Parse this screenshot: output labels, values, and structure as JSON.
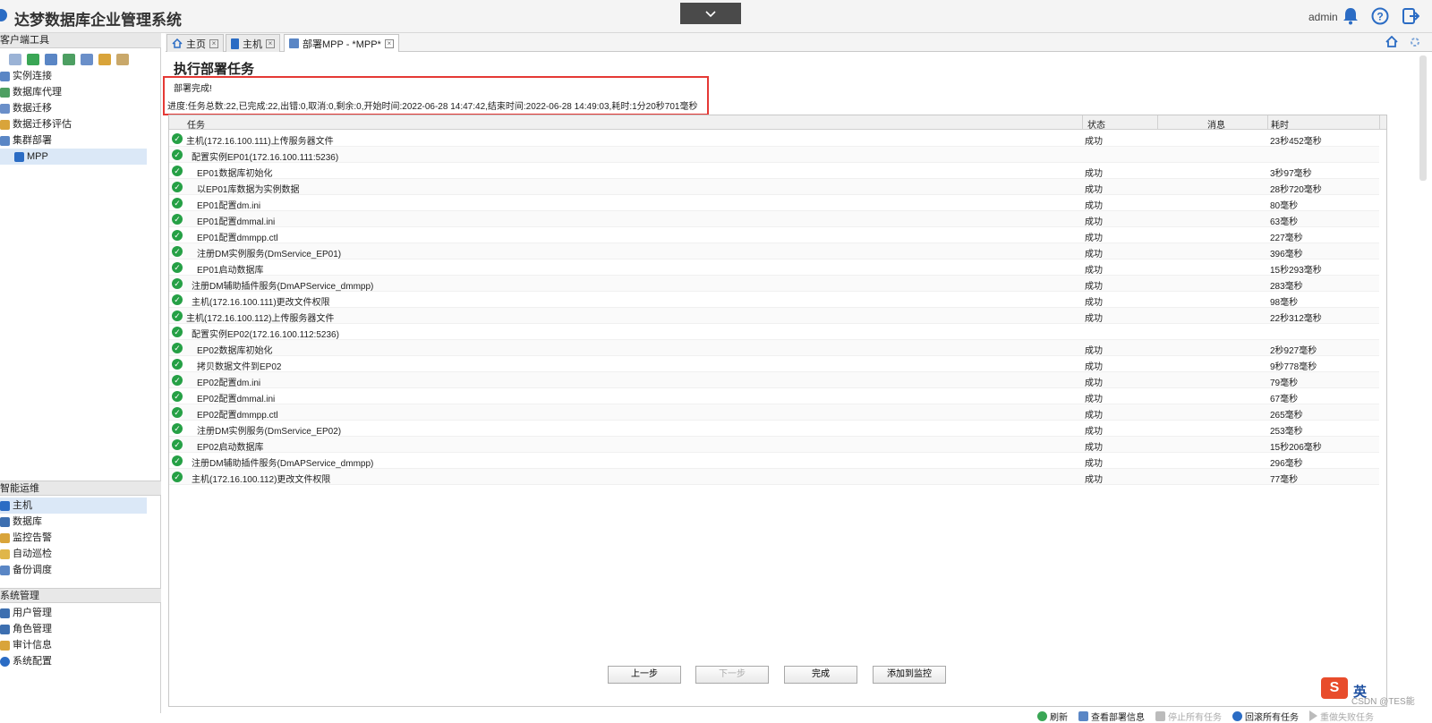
{
  "app": {
    "title": "达梦数据库企业管理系统",
    "user": "admin"
  },
  "sidebar": {
    "client_tools": {
      "title": "客户端工具",
      "items": [
        {
          "label": "实例连接"
        },
        {
          "label": "数据库代理"
        },
        {
          "label": "数据迁移"
        },
        {
          "label": "数据迁移评估"
        },
        {
          "label": "集群部署"
        },
        {
          "label": "MPP"
        }
      ]
    },
    "ops": {
      "title": "智能运维",
      "items": [
        {
          "label": "主机"
        },
        {
          "label": "数据库"
        },
        {
          "label": "监控告警"
        },
        {
          "label": "自动巡检"
        },
        {
          "label": "备份调度"
        }
      ]
    },
    "sys": {
      "title": "系统管理",
      "items": [
        {
          "label": "用户管理"
        },
        {
          "label": "角色管理"
        },
        {
          "label": "审计信息"
        },
        {
          "label": "系统配置"
        }
      ]
    }
  },
  "tabs": [
    {
      "label": "主页"
    },
    {
      "label": "主机"
    },
    {
      "label": "部署MPP - *MPP*"
    }
  ],
  "main": {
    "title": "执行部署任务",
    "status": "部署完成!",
    "progress": "进度:任务总数:22,已完成:22,出错:0,取消:0,剩余:0,开始时间:2022-06-28 14:47:42,结束时间:2022-06-28 14:49:03,耗时:1分20秒701毫秒",
    "columns": {
      "task": "任务",
      "status": "状态",
      "message": "消息",
      "time": "耗时"
    }
  },
  "rows": [
    {
      "task": "主机(172.16.100.111)上传服务器文件",
      "status": "成功",
      "time": "23秒452毫秒"
    },
    {
      "task": "配置实例EP01(172.16.100.111:5236)",
      "status": "",
      "time": ""
    },
    {
      "task": "EP01数据库初始化",
      "status": "成功",
      "time": "3秒97毫秒"
    },
    {
      "task": "以EP01库数据为实例数据",
      "status": "成功",
      "time": "28秒720毫秒"
    },
    {
      "task": "EP01配置dm.ini",
      "status": "成功",
      "time": "80毫秒"
    },
    {
      "task": "EP01配置dmmal.ini",
      "status": "成功",
      "time": "63毫秒"
    },
    {
      "task": "EP01配置dmmpp.ctl",
      "status": "成功",
      "time": "227毫秒"
    },
    {
      "task": "注册DM实例服务(DmService_EP01)",
      "status": "成功",
      "time": "396毫秒"
    },
    {
      "task": "EP01启动数据库",
      "status": "成功",
      "time": "15秒293毫秒"
    },
    {
      "task": "注册DM辅助插件服务(DmAPService_dmmpp)",
      "status": "成功",
      "time": "283毫秒"
    },
    {
      "task": "主机(172.16.100.111)更改文件权限",
      "status": "成功",
      "time": "98毫秒"
    },
    {
      "task": "主机(172.16.100.112)上传服务器文件",
      "status": "成功",
      "time": "22秒312毫秒"
    },
    {
      "task": "配置实例EP02(172.16.100.112:5236)",
      "status": "",
      "time": ""
    },
    {
      "task": "EP02数据库初始化",
      "status": "成功",
      "time": "2秒927毫秒"
    },
    {
      "task": "拷贝数据文件到EP02",
      "status": "成功",
      "time": "9秒778毫秒"
    },
    {
      "task": "EP02配置dm.ini",
      "status": "成功",
      "time": "79毫秒"
    },
    {
      "task": "EP02配置dmmal.ini",
      "status": "成功",
      "time": "67毫秒"
    },
    {
      "task": "EP02配置dmmpp.ctl",
      "status": "成功",
      "time": "265毫秒"
    },
    {
      "task": "注册DM实例服务(DmService_EP02)",
      "status": "成功",
      "time": "253毫秒"
    },
    {
      "task": "EP02启动数据库",
      "status": "成功",
      "time": "15秒206毫秒"
    },
    {
      "task": "注册DM辅助插件服务(DmAPService_dmmpp)",
      "status": "成功",
      "time": "296毫秒"
    },
    {
      "task": "主机(172.16.100.112)更改文件权限",
      "status": "成功",
      "time": "77毫秒"
    }
  ],
  "actions": {
    "refresh": "刷新",
    "view_info": "查看部署信息",
    "stop_all": "停止所有任务",
    "rollback_all": "回滚所有任务",
    "redo_failed": "重做失败任务"
  },
  "buttons": {
    "prev": "上一步",
    "next": "下一步",
    "finish": "完成",
    "add_monitor": "添加到监控"
  },
  "footer": {
    "ime_lang": "英",
    "watermark": "CSDN @TES能"
  },
  "colors": {
    "accent": "#2b6cc4",
    "success": "#25a045",
    "highlight_box": "#e53935"
  }
}
